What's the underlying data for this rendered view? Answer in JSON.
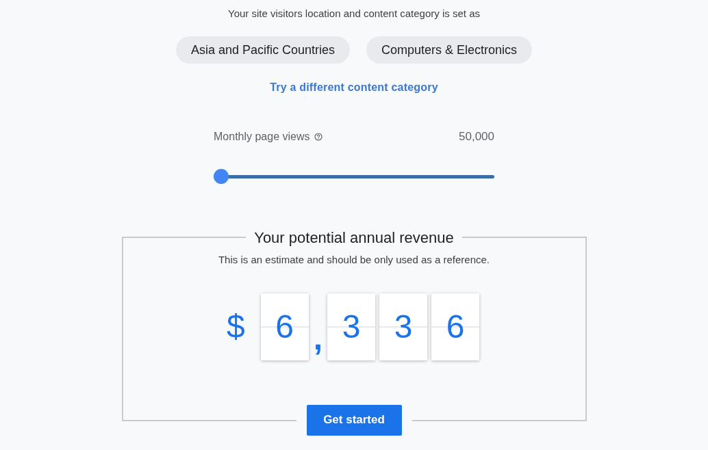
{
  "intro": "Your site visitors location and content category is set as",
  "selections": [
    {
      "label": "Asia and Pacific Countries"
    },
    {
      "label": "Computers & Electronics"
    }
  ],
  "change_link": "Try a different content category",
  "page_views": {
    "label": "Monthly page views",
    "value": "50,000",
    "level": 0
  },
  "revenue": {
    "title": "Your potential annual revenue",
    "note": "This is an estimate and should be only used as a reference.",
    "currency": "$",
    "figures": [
      {
        "kind": "digit",
        "text": "6"
      },
      {
        "kind": "separator",
        "text": ","
      },
      {
        "kind": "digit",
        "text": "3"
      },
      {
        "kind": "digit",
        "text": "3"
      },
      {
        "kind": "digit",
        "text": "6"
      }
    ]
  },
  "button": "Get started"
}
